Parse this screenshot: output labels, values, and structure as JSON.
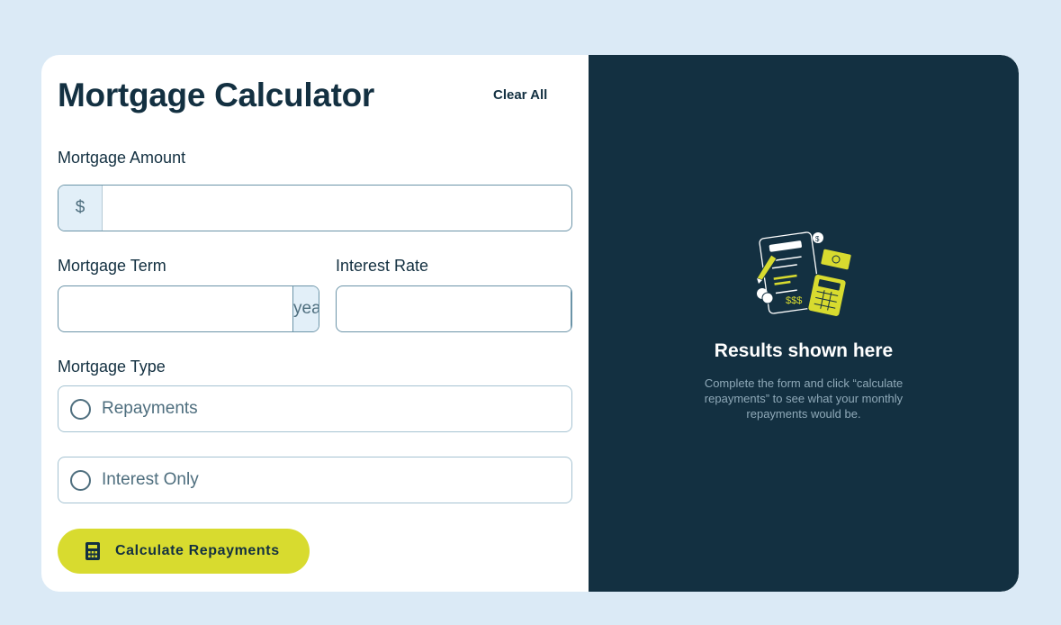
{
  "header": {
    "title": "Mortgage Calculator",
    "clear_all_label": "Clear All"
  },
  "form": {
    "amount": {
      "label": "Mortgage Amount",
      "prefix": "$",
      "value": ""
    },
    "term": {
      "label": "Mortgage Term",
      "suffix": "years",
      "value": ""
    },
    "rate": {
      "label": "Interest Rate",
      "suffix": "%",
      "value": ""
    },
    "type": {
      "label": "Mortgage Type",
      "options": [
        "Repayments",
        "Interest Only"
      ],
      "selected": null
    },
    "submit_label": "Calculate Repayments"
  },
  "results": {
    "title": "Results shown here",
    "text": "Complete the form and click “calculate repayments” to see what your monthly repayments would be."
  },
  "colors": {
    "background": "#dbeaf6",
    "panel": "#133041",
    "accent": "#d8db2f",
    "slate": "#4e6e7e"
  },
  "icons": [
    "calculator-icon",
    "empty-results-illustration"
  ]
}
